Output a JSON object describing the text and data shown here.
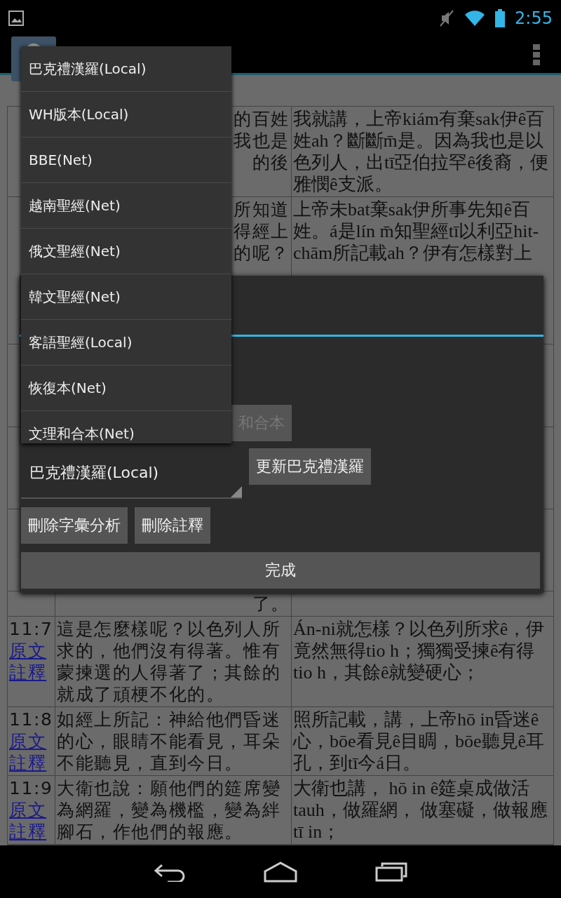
{
  "status_bar": {
    "time": "2:55"
  },
  "table": {
    "rows": [
      {
        "kind": "clipped",
        "text_lines": [
          "的百姓",
          "我也是",
          "的後"
        ],
        "taigi": "我就講，上帝kiám有棄sak伊ê百姓ah？斷斷m̄是。因為我也是以色列人，出tī亞伯拉罕ê後裔，便雅憫ê支派。"
      },
      {
        "kind": "covered",
        "text_lines": [
          "所知道",
          "得經上",
          "的呢？"
        ],
        "taigi_lines": [
          "上帝未bat棄sak伊所事先知ê百",
          "姓。á是lín m̄知聖經tī以利亞hit-",
          "chām所記載ah？伊有怎樣對上"
        ]
      },
      {
        "kind": "covered",
        "text_lines": []
      },
      {
        "kind": "covered",
        "text_lines": []
      },
      {
        "kind": "covered",
        "text_lines": []
      },
      {
        "kind": "clipped",
        "text_lines": [
          "了。"
        ]
      },
      {
        "kind": "full",
        "verse": "11:7",
        "links": [
          "原文",
          "註釋"
        ],
        "text": "這是怎麼樣呢？以色列人所求的，他們沒有得著。惟有蒙揀選的人得著了；其餘的就成了頑梗不化的。",
        "taigi": "Án-ni就怎樣？以色列所求ê，伊竟然無得tio h；獨獨受揀ê有得tio h，其餘ê就變硬心；"
      },
      {
        "kind": "full",
        "verse": "11:8",
        "links": [
          "原文",
          "註釋"
        ],
        "text": "如經上所記：神給他們昏迷的心，眼睛不能看見，耳朵不能聽見，直到今日。",
        "taigi": "照所記載，講，上帝hō  in昏迷ê心，bōe看見ê目睭，bōe聽見ê耳孔，到tī今á日。"
      },
      {
        "kind": "full",
        "verse": "11:9",
        "links": [
          "原文",
          "註釋"
        ],
        "text": "大衛也說：願他們的筵席變為網羅，變為機檻，變為絆腳石，作他們的報應。",
        "taigi": "大衛也講， hō  in ê筵桌成做活tauh，做羅網， 做塞礙，做報應tī in；"
      }
    ]
  },
  "dialog": {
    "partial_button": {
      "label": "和合本",
      "disabled": true
    },
    "spinner": {
      "value": "巴克禮漢羅(Local)"
    },
    "update_button": "更新巴克禮漢羅",
    "delete_buttons": [
      "刪除字彙分析",
      "刪除註釋"
    ],
    "done_button": "完成"
  },
  "dropdown": {
    "items": [
      "巴克禮漢羅(Local)",
      "WH版本(Local)",
      "BBE(Net)",
      "越南聖經(Net)",
      "俄文聖經(Net)",
      "韓文聖經(Net)",
      "客語聖經(Local)",
      "恢復本(Net)",
      "文理和合本(Net)"
    ]
  }
}
